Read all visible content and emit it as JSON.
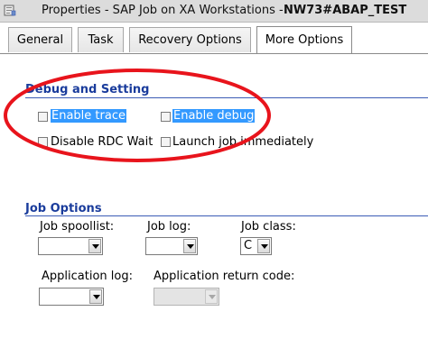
{
  "window": {
    "title": "Properties - SAP Job on XA Workstations -",
    "title_bold": "NW73#ABAP_TEST",
    "icon": "properties-document-icon"
  },
  "tabs": [
    {
      "label": "General",
      "active": false
    },
    {
      "label": "Task",
      "active": false
    },
    {
      "label": "Recovery Options",
      "active": false
    },
    {
      "label": "More Options",
      "active": true
    }
  ],
  "debug_section": {
    "title": "Debug and Setting",
    "checkboxes": [
      {
        "label": "Enable trace",
        "checked": false,
        "highlighted": true
      },
      {
        "label": "Enable debug",
        "checked": false,
        "highlighted": true
      },
      {
        "label": "Disable RDC Wait",
        "checked": false,
        "highlighted": false
      },
      {
        "label": "Launch job immediately",
        "checked": false,
        "highlighted": false
      }
    ]
  },
  "job_options": {
    "title": "Job Options",
    "job_spoollist": {
      "label": "Job spoollist:",
      "value": ""
    },
    "job_log": {
      "label": "Job log:",
      "value": ""
    },
    "job_class": {
      "label": "Job class:",
      "value": "C"
    },
    "application_log": {
      "label": "Application log:",
      "value": ""
    },
    "application_return_code": {
      "label": "Application return code:",
      "value": "",
      "disabled": true
    }
  },
  "colors": {
    "section_title": "#1a3c9c",
    "selection_highlight": "#3399ff",
    "annotation_oval": "#e8141c"
  }
}
